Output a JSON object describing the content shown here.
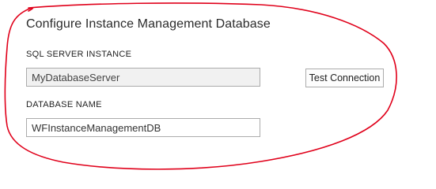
{
  "dialog": {
    "title": "Configure Instance Management Database",
    "sql_server_instance": {
      "label": "SQL SERVER INSTANCE",
      "value": "MyDatabaseServer"
    },
    "test_connection_label": "Test Connection",
    "database_name": {
      "label": "DATABASE NAME",
      "value": "WFInstanceManagementDB"
    }
  },
  "annotation": {
    "shape": "hand-drawn ellipse",
    "color": "#e0001a"
  },
  "colors": {
    "background": "#ffffff",
    "field_border": "#ababab",
    "readonly_field_bg": "#f1f1f1"
  }
}
